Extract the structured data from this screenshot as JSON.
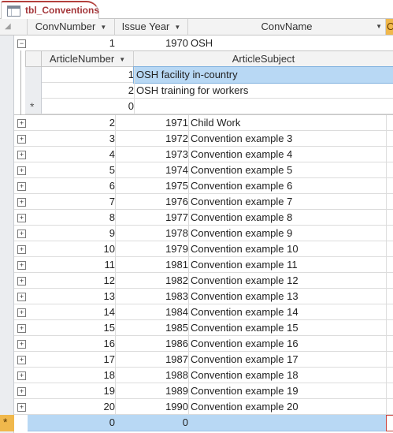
{
  "tab": {
    "label": "tbl_Conventions",
    "icon": "table-icon"
  },
  "columns": {
    "conv_number": "ConvNumber",
    "issue_year": "Issue Year",
    "conv_name": "ConvName",
    "extra": "C"
  },
  "expanded_row": {
    "conv_number": "1",
    "issue_year": "1970",
    "conv_name": "OSH",
    "expander": "−"
  },
  "subdatasheet": {
    "columns": {
      "article_number": "ArticleNumber",
      "article_subject": "ArticleSubject"
    },
    "rows": [
      {
        "article_number": "1",
        "article_subject": "OSH facility in-country"
      },
      {
        "article_number": "2",
        "article_subject": "OSH training for workers"
      }
    ],
    "new_row": {
      "marker": "*",
      "article_number": "0"
    }
  },
  "rows": [
    {
      "conv_number": "2",
      "issue_year": "1971",
      "conv_name": "Child Work"
    },
    {
      "conv_number": "3",
      "issue_year": "1972",
      "conv_name": "Convention example 3"
    },
    {
      "conv_number": "4",
      "issue_year": "1973",
      "conv_name": "Convention example 4"
    },
    {
      "conv_number": "5",
      "issue_year": "1974",
      "conv_name": "Convention example 5"
    },
    {
      "conv_number": "6",
      "issue_year": "1975",
      "conv_name": "Convention example 6"
    },
    {
      "conv_number": "7",
      "issue_year": "1976",
      "conv_name": "Convention example 7"
    },
    {
      "conv_number": "8",
      "issue_year": "1977",
      "conv_name": "Convention example 8"
    },
    {
      "conv_number": "9",
      "issue_year": "1978",
      "conv_name": "Convention example 9"
    },
    {
      "conv_number": "10",
      "issue_year": "1979",
      "conv_name": "Convention example 10"
    },
    {
      "conv_number": "11",
      "issue_year": "1981",
      "conv_name": "Convention example 11"
    },
    {
      "conv_number": "12",
      "issue_year": "1982",
      "conv_name": "Convention example 12"
    },
    {
      "conv_number": "13",
      "issue_year": "1983",
      "conv_name": "Convention example 13"
    },
    {
      "conv_number": "14",
      "issue_year": "1984",
      "conv_name": "Convention example 14"
    },
    {
      "conv_number": "15",
      "issue_year": "1985",
      "conv_name": "Convention example 15"
    },
    {
      "conv_number": "16",
      "issue_year": "1986",
      "conv_name": "Convention example 16"
    },
    {
      "conv_number": "17",
      "issue_year": "1987",
      "conv_name": "Convention example 17"
    },
    {
      "conv_number": "18",
      "issue_year": "1988",
      "conv_name": "Convention example 18"
    },
    {
      "conv_number": "19",
      "issue_year": "1989",
      "conv_name": "Convention example 19"
    },
    {
      "conv_number": "20",
      "issue_year": "1990",
      "conv_name": "Convention example 20"
    }
  ],
  "new_row": {
    "marker": "*",
    "conv_number": "0",
    "issue_year": "0"
  },
  "expander_collapsed": "+",
  "colors": {
    "tab_accent": "#a5373b",
    "selection": "#b8d8f4",
    "header_active": "#f0b84c"
  }
}
